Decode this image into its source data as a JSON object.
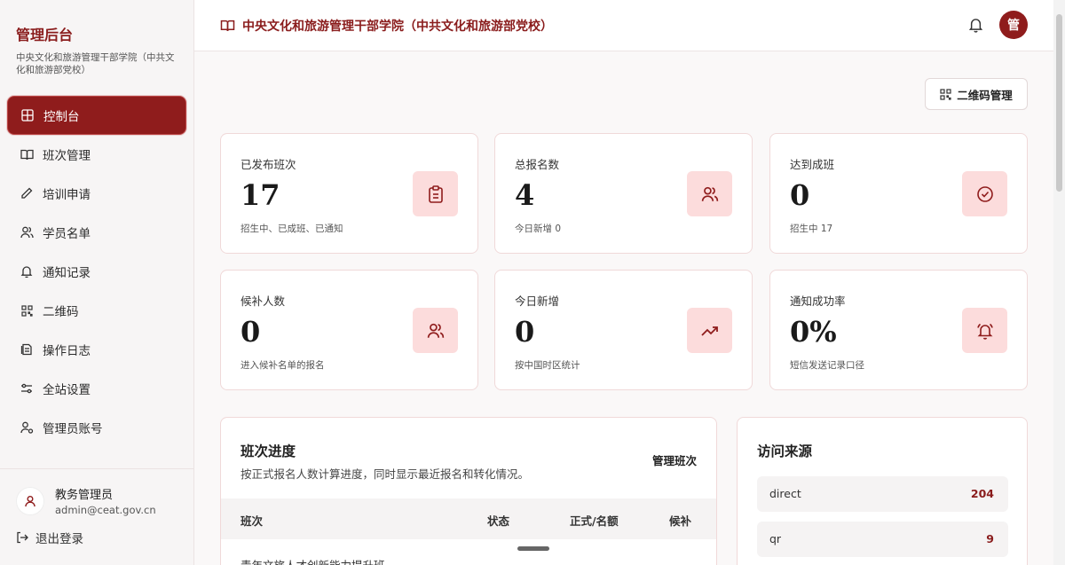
{
  "sidebar": {
    "title": "管理后台",
    "subtitle": "中央文化和旅游管理干部学院（中共文化和旅游部党校）",
    "items": [
      {
        "label": "控制台",
        "icon": "dashboard-icon",
        "active": true
      },
      {
        "label": "班次管理",
        "icon": "book-icon"
      },
      {
        "label": "培训申请",
        "icon": "pencil-icon"
      },
      {
        "label": "学员名单",
        "icon": "users-icon"
      },
      {
        "label": "通知记录",
        "icon": "bell-icon"
      },
      {
        "label": "二维码",
        "icon": "qr-code-icon"
      },
      {
        "label": "操作日志",
        "icon": "log-icon"
      },
      {
        "label": "全站设置",
        "icon": "settings-icon"
      },
      {
        "label": "管理员账号",
        "icon": "admin-icon"
      }
    ],
    "user": {
      "name": "教务管理员",
      "email": "admin@ceat.gov.cn"
    },
    "logout": "退出登录"
  },
  "header": {
    "title": "中央文化和旅游管理干部学院（中共文化和旅游部党校）",
    "avatar": "管"
  },
  "toolbar": {
    "qr_button": "二维码管理"
  },
  "stats": [
    {
      "label": "已发布班次",
      "value": "17",
      "note": "招生中、已成班、已通知",
      "icon": "clipboard-icon"
    },
    {
      "label": "总报名数",
      "value": "4",
      "note": "今日新增 0",
      "icon": "users-icon"
    },
    {
      "label": "达到成班",
      "value": "0",
      "note": "招生中 17",
      "icon": "check-circle-icon"
    },
    {
      "label": "候补人数",
      "value": "0",
      "note": "进入候补名单的报名",
      "icon": "users-icon"
    },
    {
      "label": "今日新增",
      "value": "0",
      "note": "按中国时区统计",
      "icon": "trending-up-icon"
    },
    {
      "label": "通知成功率",
      "value": "0%",
      "note": "短信发送记录口径",
      "icon": "bell-ring-icon"
    }
  ],
  "progress": {
    "title": "班次进度",
    "desc": "按正式报名人数计算进度，同时显示最近报名和转化情况。",
    "link": "管理班次",
    "columns": [
      "班次",
      "状态",
      "正式/名额",
      "候补"
    ],
    "first_row": "青年文旅人才创新能力提升班"
  },
  "sources": {
    "title": "访问来源",
    "rows": [
      {
        "name": "direct",
        "count": "204"
      },
      {
        "name": "qr",
        "count": "9"
      }
    ]
  },
  "colors": {
    "brand": "#8f1c1c",
    "icon_bg": "#fcdcdc"
  }
}
